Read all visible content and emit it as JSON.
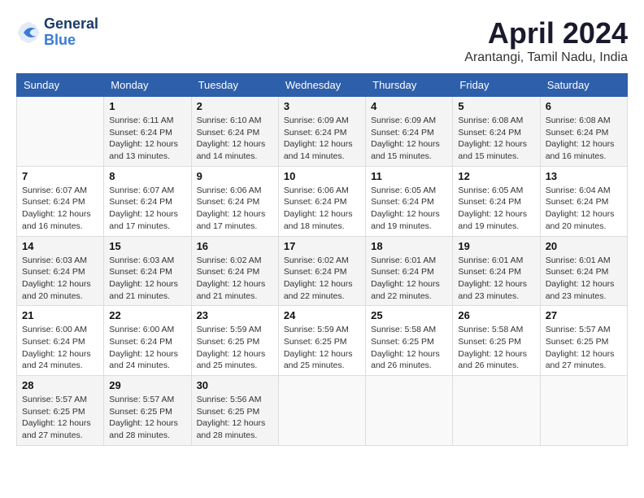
{
  "header": {
    "logo_line1": "General",
    "logo_line2": "Blue",
    "title": "April 2024",
    "subtitle": "Arantangi, Tamil Nadu, India"
  },
  "columns": [
    "Sunday",
    "Monday",
    "Tuesday",
    "Wednesday",
    "Thursday",
    "Friday",
    "Saturday"
  ],
  "weeks": [
    [
      {
        "day": "",
        "sunrise": "",
        "sunset": "",
        "daylight": ""
      },
      {
        "day": "1",
        "sunrise": "Sunrise: 6:11 AM",
        "sunset": "Sunset: 6:24 PM",
        "daylight": "Daylight: 12 hours and 13 minutes."
      },
      {
        "day": "2",
        "sunrise": "Sunrise: 6:10 AM",
        "sunset": "Sunset: 6:24 PM",
        "daylight": "Daylight: 12 hours and 14 minutes."
      },
      {
        "day": "3",
        "sunrise": "Sunrise: 6:09 AM",
        "sunset": "Sunset: 6:24 PM",
        "daylight": "Daylight: 12 hours and 14 minutes."
      },
      {
        "day": "4",
        "sunrise": "Sunrise: 6:09 AM",
        "sunset": "Sunset: 6:24 PM",
        "daylight": "Daylight: 12 hours and 15 minutes."
      },
      {
        "day": "5",
        "sunrise": "Sunrise: 6:08 AM",
        "sunset": "Sunset: 6:24 PM",
        "daylight": "Daylight: 12 hours and 15 minutes."
      },
      {
        "day": "6",
        "sunrise": "Sunrise: 6:08 AM",
        "sunset": "Sunset: 6:24 PM",
        "daylight": "Daylight: 12 hours and 16 minutes."
      }
    ],
    [
      {
        "day": "7",
        "sunrise": "Sunrise: 6:07 AM",
        "sunset": "Sunset: 6:24 PM",
        "daylight": "Daylight: 12 hours and 16 minutes."
      },
      {
        "day": "8",
        "sunrise": "Sunrise: 6:07 AM",
        "sunset": "Sunset: 6:24 PM",
        "daylight": "Daylight: 12 hours and 17 minutes."
      },
      {
        "day": "9",
        "sunrise": "Sunrise: 6:06 AM",
        "sunset": "Sunset: 6:24 PM",
        "daylight": "Daylight: 12 hours and 17 minutes."
      },
      {
        "day": "10",
        "sunrise": "Sunrise: 6:06 AM",
        "sunset": "Sunset: 6:24 PM",
        "daylight": "Daylight: 12 hours and 18 minutes."
      },
      {
        "day": "11",
        "sunrise": "Sunrise: 6:05 AM",
        "sunset": "Sunset: 6:24 PM",
        "daylight": "Daylight: 12 hours and 19 minutes."
      },
      {
        "day": "12",
        "sunrise": "Sunrise: 6:05 AM",
        "sunset": "Sunset: 6:24 PM",
        "daylight": "Daylight: 12 hours and 19 minutes."
      },
      {
        "day": "13",
        "sunrise": "Sunrise: 6:04 AM",
        "sunset": "Sunset: 6:24 PM",
        "daylight": "Daylight: 12 hours and 20 minutes."
      }
    ],
    [
      {
        "day": "14",
        "sunrise": "Sunrise: 6:03 AM",
        "sunset": "Sunset: 6:24 PM",
        "daylight": "Daylight: 12 hours and 20 minutes."
      },
      {
        "day": "15",
        "sunrise": "Sunrise: 6:03 AM",
        "sunset": "Sunset: 6:24 PM",
        "daylight": "Daylight: 12 hours and 21 minutes."
      },
      {
        "day": "16",
        "sunrise": "Sunrise: 6:02 AM",
        "sunset": "Sunset: 6:24 PM",
        "daylight": "Daylight: 12 hours and 21 minutes."
      },
      {
        "day": "17",
        "sunrise": "Sunrise: 6:02 AM",
        "sunset": "Sunset: 6:24 PM",
        "daylight": "Daylight: 12 hours and 22 minutes."
      },
      {
        "day": "18",
        "sunrise": "Sunrise: 6:01 AM",
        "sunset": "Sunset: 6:24 PM",
        "daylight": "Daylight: 12 hours and 22 minutes."
      },
      {
        "day": "19",
        "sunrise": "Sunrise: 6:01 AM",
        "sunset": "Sunset: 6:24 PM",
        "daylight": "Daylight: 12 hours and 23 minutes."
      },
      {
        "day": "20",
        "sunrise": "Sunrise: 6:01 AM",
        "sunset": "Sunset: 6:24 PM",
        "daylight": "Daylight: 12 hours and 23 minutes."
      }
    ],
    [
      {
        "day": "21",
        "sunrise": "Sunrise: 6:00 AM",
        "sunset": "Sunset: 6:24 PM",
        "daylight": "Daylight: 12 hours and 24 minutes."
      },
      {
        "day": "22",
        "sunrise": "Sunrise: 6:00 AM",
        "sunset": "Sunset: 6:24 PM",
        "daylight": "Daylight: 12 hours and 24 minutes."
      },
      {
        "day": "23",
        "sunrise": "Sunrise: 5:59 AM",
        "sunset": "Sunset: 6:25 PM",
        "daylight": "Daylight: 12 hours and 25 minutes."
      },
      {
        "day": "24",
        "sunrise": "Sunrise: 5:59 AM",
        "sunset": "Sunset: 6:25 PM",
        "daylight": "Daylight: 12 hours and 25 minutes."
      },
      {
        "day": "25",
        "sunrise": "Sunrise: 5:58 AM",
        "sunset": "Sunset: 6:25 PM",
        "daylight": "Daylight: 12 hours and 26 minutes."
      },
      {
        "day": "26",
        "sunrise": "Sunrise: 5:58 AM",
        "sunset": "Sunset: 6:25 PM",
        "daylight": "Daylight: 12 hours and 26 minutes."
      },
      {
        "day": "27",
        "sunrise": "Sunrise: 5:57 AM",
        "sunset": "Sunset: 6:25 PM",
        "daylight": "Daylight: 12 hours and 27 minutes."
      }
    ],
    [
      {
        "day": "28",
        "sunrise": "Sunrise: 5:57 AM",
        "sunset": "Sunset: 6:25 PM",
        "daylight": "Daylight: 12 hours and 27 minutes."
      },
      {
        "day": "29",
        "sunrise": "Sunrise: 5:57 AM",
        "sunset": "Sunset: 6:25 PM",
        "daylight": "Daylight: 12 hours and 28 minutes."
      },
      {
        "day": "30",
        "sunrise": "Sunrise: 5:56 AM",
        "sunset": "Sunset: 6:25 PM",
        "daylight": "Daylight: 12 hours and 28 minutes."
      },
      {
        "day": "",
        "sunrise": "",
        "sunset": "",
        "daylight": ""
      },
      {
        "day": "",
        "sunrise": "",
        "sunset": "",
        "daylight": ""
      },
      {
        "day": "",
        "sunrise": "",
        "sunset": "",
        "daylight": ""
      },
      {
        "day": "",
        "sunrise": "",
        "sunset": "",
        "daylight": ""
      }
    ]
  ]
}
